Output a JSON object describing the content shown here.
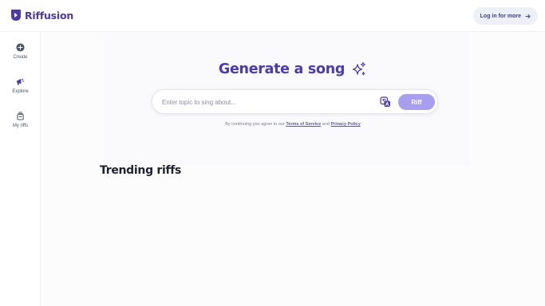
{
  "brand": {
    "name": "Riffusion",
    "color": "#4a3aa8"
  },
  "header": {
    "login_label": "Log in for more",
    "login_icon": "arrow-right-icon"
  },
  "sidebar": {
    "items": [
      {
        "label": "Create",
        "icon": "plus-circle-icon"
      },
      {
        "label": "Explore",
        "icon": "megaphone-icon"
      },
      {
        "label": "My riffs",
        "icon": "stack-icon"
      }
    ]
  },
  "hero": {
    "title": "Generate a song",
    "title_icon": "sparkles-icon",
    "title_color": "#4b3ab0",
    "search": {
      "placeholder": "Enter topic to sing about...",
      "value": ""
    },
    "language_icon": "translate-icon",
    "submit_label": "Riff",
    "submit_color": "#a89ef0",
    "terms": {
      "prefix": "By continuing you agree to our",
      "terms_link": "Terms of Service",
      "conjunction": "and",
      "privacy_link": "Privacy Policy"
    }
  },
  "trending": {
    "title": "Trending riffs"
  }
}
